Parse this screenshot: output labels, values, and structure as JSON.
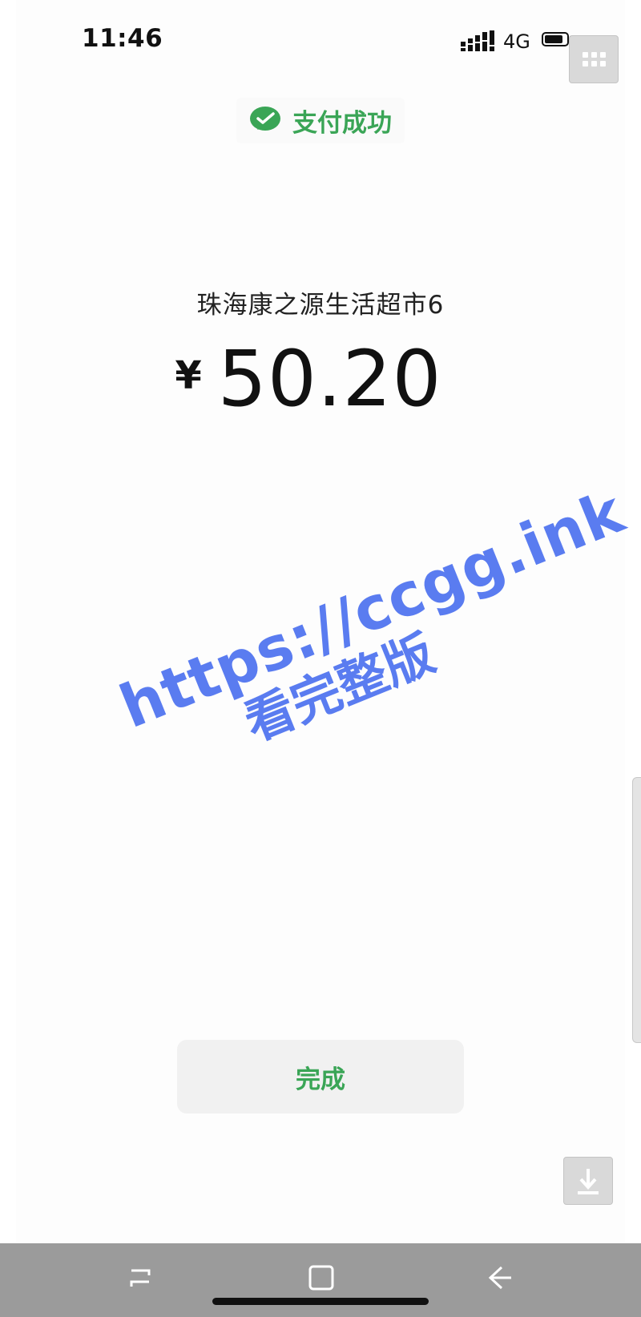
{
  "status_bar": {
    "time": "11:46",
    "network": "4G"
  },
  "header": {
    "success_text": "支付成功",
    "success_icon": "wechat-pay-icon",
    "accent_color": "#3aa556"
  },
  "payment": {
    "merchant": "珠海康之源生活超市6",
    "currency_symbol": "¥",
    "amount": "50.20"
  },
  "watermark": {
    "url": "https://ccgg.ink",
    "text": "看完整版",
    "color": "#5a7cf0"
  },
  "actions": {
    "done_label": "完成"
  },
  "floating": {
    "assistive_icon": "grid-menu-icon",
    "download_icon": "download-icon"
  },
  "nav": {
    "recent_icon": "recent-apps-icon",
    "home_icon": "home-icon",
    "back_icon": "back-icon"
  }
}
